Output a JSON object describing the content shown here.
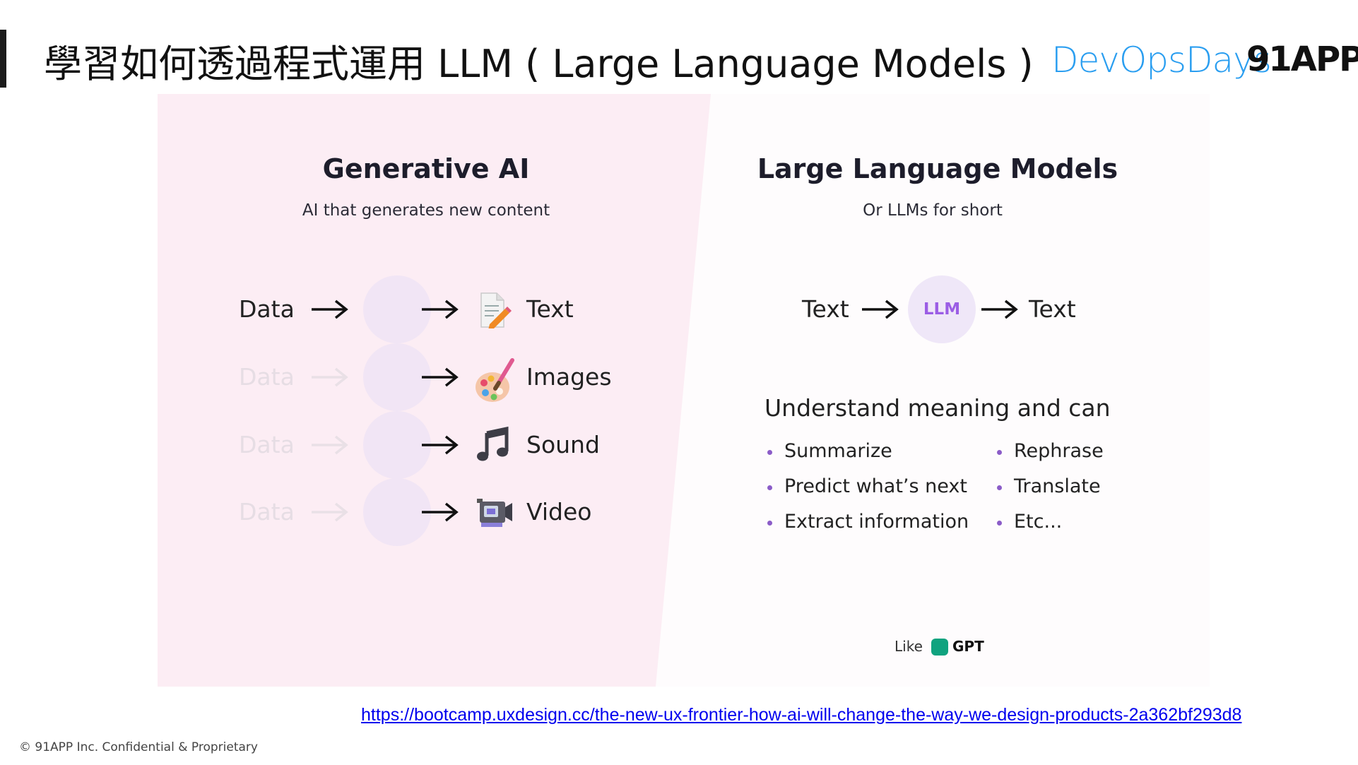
{
  "slide": {
    "title": "學習如何透過程式運用 LLM ( Large Language Models )",
    "logos": {
      "devopsdays": "DevOpsDays",
      "company": "91APP"
    },
    "source_url": "https://bootcamp.uxdesign.cc/the-new-ux-frontier-how-ai-will-change-the-way-we-design-products-2a362bf293d8",
    "footer": "© 91APP Inc. Confidential & Proprietary"
  },
  "generative": {
    "title": "Generative AI",
    "subtitle": "AI that generates new content",
    "input_label": "Data",
    "rows": [
      {
        "input": "Data",
        "output": "Text",
        "icon": "document-pencil-icon"
      },
      {
        "input": "Data",
        "output": "Images",
        "icon": "palette-icon"
      },
      {
        "input": "Data",
        "output": "Sound",
        "icon": "music-note-icon"
      },
      {
        "input": "Data",
        "output": "Video",
        "icon": "video-camera-icon"
      }
    ]
  },
  "llm": {
    "title": "Large Language Models",
    "subtitle": "Or LLMs for short",
    "flow": {
      "input": "Text",
      "node": "LLM",
      "output": "Text"
    },
    "understand": "Understand meaning and can",
    "capabilities_left": [
      "Summarize",
      "Predict what’s next",
      "Extract information"
    ],
    "capabilities_right": [
      "Rephrase",
      "Translate",
      "Etc..."
    ],
    "like_label": "Like",
    "like_brand": "GPT"
  },
  "colors": {
    "panel_pink": "#fcedf4",
    "circle": "#f1e5f5",
    "llm_text": "#9b5de5",
    "bullet": "#8b5cc8",
    "link": "#0000ee",
    "devops_blue": "#2a9ef0",
    "gpt_green": "#10a37f"
  }
}
